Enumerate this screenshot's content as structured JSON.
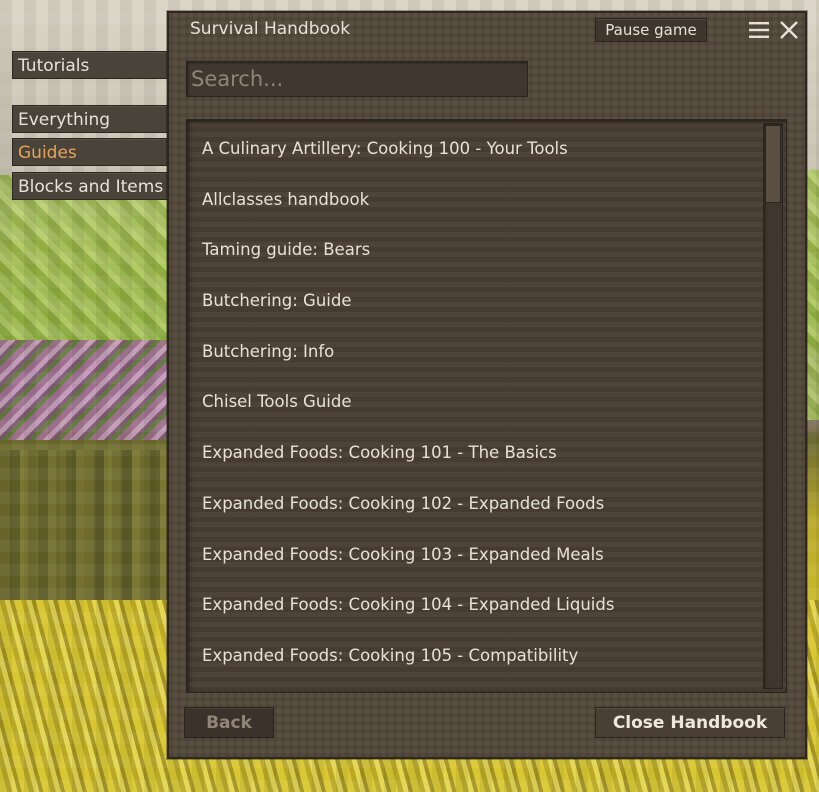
{
  "tabs": {
    "tutorials": "Tutorials",
    "everything": "Everything",
    "guides": "Guides",
    "blocks_items": "Blocks and Items",
    "active": "Guides"
  },
  "dialog": {
    "title": "Survival Handbook",
    "pause_label": "Pause game",
    "menu_icon": "hamburger-menu-icon",
    "close_icon": "close-x-icon",
    "search_placeholder": "Search...",
    "search_value": "",
    "back_label": "Back",
    "close_label": "Close Handbook"
  },
  "guides": [
    "A Culinary Artillery: Cooking 100 - Your Tools",
    "Allclasses handbook",
    "Taming guide: Bears",
    "Butchering: Guide",
    "Butchering: Info",
    "Chisel Tools Guide",
    "Expanded Foods: Cooking 101 - The Basics",
    "Expanded Foods: Cooking 102 - Expanded Foods",
    "Expanded Foods: Cooking 103 - Expanded Meals",
    "Expanded Foods: Cooking 104 - Expanded Liquids",
    "Expanded Foods: Cooking 105 - Compatibility"
  ],
  "colors": {
    "active_tab": "#e6a45a",
    "text": "#e8e2d6",
    "panel": "#54483b"
  }
}
